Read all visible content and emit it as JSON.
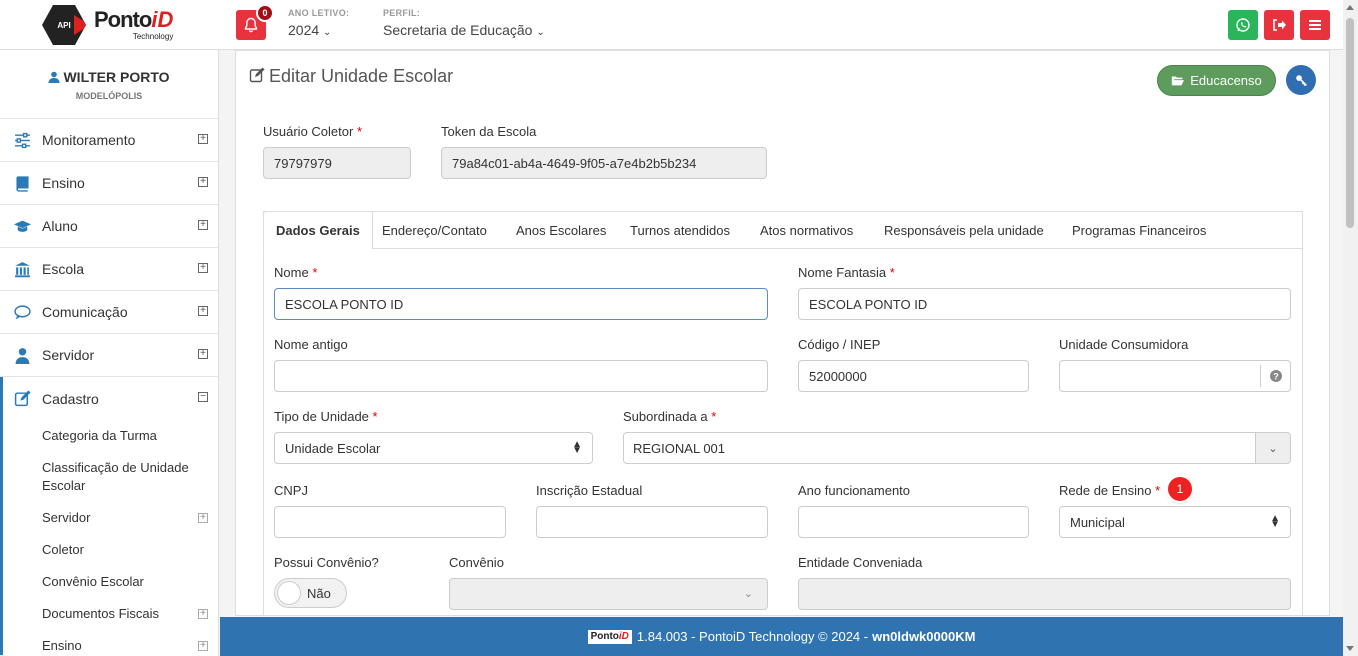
{
  "app": {
    "logo_badge": "API",
    "logo_name": "Ponto",
    "logo_accent": "iD",
    "logo_sub": "Technology"
  },
  "header": {
    "notifications_count": "0",
    "ano_letivo_label": "ANO LETIVO:",
    "ano_letivo_value": "2024",
    "perfil_label": "PERFIL:",
    "perfil_value": "Secretaria de Educação"
  },
  "colors": {
    "whatsapp": "#2bb55a",
    "danger": "#e8333f",
    "primary": "#2f73b0",
    "educacenso": "#5d9c5d"
  },
  "user": {
    "name": "WILTER PORTO",
    "city": "MODELÓPOLIS"
  },
  "sidebar": {
    "items": [
      {
        "label": "Monitoramento",
        "icon": "sliders-icon",
        "expand": "⊞"
      },
      {
        "label": "Ensino",
        "icon": "book-icon",
        "expand": "⊞"
      },
      {
        "label": "Aluno",
        "icon": "graduation-cap-icon",
        "expand": "⊞"
      },
      {
        "label": "Escola",
        "icon": "institution-icon",
        "expand": "⊞"
      },
      {
        "label": "Comunicação",
        "icon": "chat-icon",
        "expand": "⊞"
      },
      {
        "label": "Servidor",
        "icon": "user-icon",
        "expand": "⊞"
      },
      {
        "label": "Cadastro",
        "icon": "edit-icon",
        "expand": "⊟"
      }
    ],
    "sub_items": [
      {
        "label": "Categoria da Turma"
      },
      {
        "label": "Classificação de Unidade Escolar"
      },
      {
        "label": "Servidor"
      },
      {
        "label": "Coletor"
      },
      {
        "label": "Convênio Escolar"
      },
      {
        "label": "Documentos Fiscais"
      },
      {
        "label": "Ensino"
      }
    ]
  },
  "page": {
    "title": "Editar Unidade Escolar",
    "educacenso_button": "Educacenso",
    "usuario_coletor_label": "Usuário Coletor",
    "usuario_coletor_value": "79797979",
    "token_label": "Token da Escola",
    "token_value": "79a84c01-ab4a-4649-9f05-a7e4b2b5b234",
    "required_mark": "*"
  },
  "tabs": [
    "Dados Gerais",
    "Endereço/Contato",
    "Anos Escolares",
    "Turnos atendidos",
    "Atos normativos",
    "Responsáveis pela unidade",
    "Programas Financeiros"
  ],
  "form": {
    "nome_label": "Nome",
    "nome_value": "ESCOLA PONTO ID",
    "nome_fantasia_label": "Nome Fantasia",
    "nome_fantasia_value": "ESCOLA PONTO ID",
    "nome_antigo_label": "Nome antigo",
    "nome_antigo_value": "",
    "codigo_inep_label": "Código / INEP",
    "codigo_inep_value": "52000000",
    "unidade_consumidora_label": "Unidade Consumidora",
    "unidade_consumidora_value": "",
    "tipo_unidade_label": "Tipo de Unidade",
    "tipo_unidade_value": "Unidade Escolar",
    "subordinada_label": "Subordinada a",
    "subordinada_value": "REGIONAL 001",
    "cnpj_label": "CNPJ",
    "cnpj_value": "",
    "inscricao_label": "Inscrição Estadual",
    "inscricao_value": "",
    "ano_func_label": "Ano funcionamento",
    "ano_func_value": "",
    "rede_label": "Rede de Ensino",
    "rede_value": "Municipal",
    "rede_hint": "1",
    "possui_convenio_label": "Possui Convênio?",
    "possui_convenio_value": "Não",
    "convenio_label": "Convênio",
    "convenio_value": "",
    "entidade_label": "Entidade Conveniada",
    "entidade_value": ""
  },
  "footer": {
    "logo_name": "Ponto",
    "logo_accent": "iD",
    "text": "1.84.003 - PontoiD Technology © 2024 -",
    "build": "wn0ldwk0000KM"
  }
}
